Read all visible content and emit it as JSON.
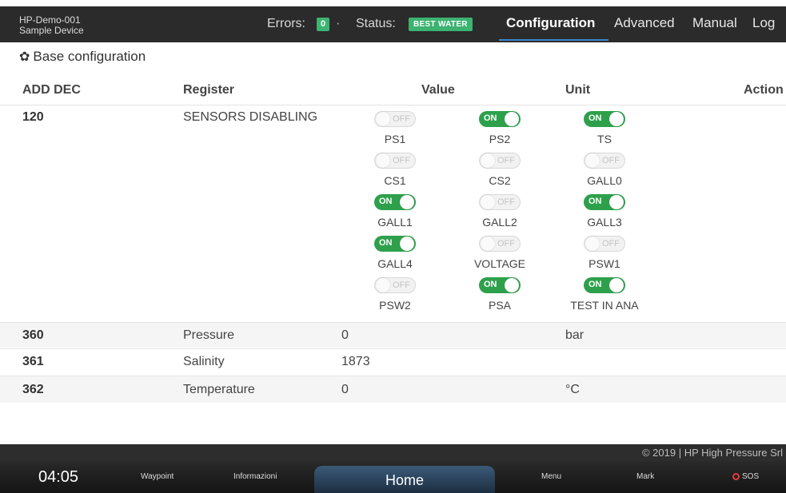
{
  "header": {
    "device_id": "HP-Demo-001",
    "device_name": "Sample Device",
    "errors_label": "Errors:",
    "errors_count": "0",
    "separator": "·",
    "status_label": "Status:",
    "status_value": "BEST WATER",
    "nav": [
      "Configuration",
      "Advanced",
      "Manual",
      "Log"
    ],
    "active_nav": "Configuration",
    "accent_color": "#3cb371"
  },
  "section": {
    "icon": "gear-icon",
    "title": "Base configuration"
  },
  "table": {
    "columns": [
      "ADD DEC",
      "Register",
      "Value",
      "Unit",
      "Action"
    ],
    "sensor_row": {
      "addr": "120",
      "register": "SENSORS DISABLING"
    },
    "on_text": "ON",
    "off_text": "OFF",
    "toggles": [
      {
        "label": "PS1",
        "state": "off"
      },
      {
        "label": "PS2",
        "state": "on"
      },
      {
        "label": "TS",
        "state": "on"
      },
      {
        "label": "CS1",
        "state": "off"
      },
      {
        "label": "CS2",
        "state": "off"
      },
      {
        "label": "GALL0",
        "state": "off"
      },
      {
        "label": "GALL1",
        "state": "on"
      },
      {
        "label": "GALL2",
        "state": "off"
      },
      {
        "label": "GALL3",
        "state": "on"
      },
      {
        "label": "GALL4",
        "state": "on"
      },
      {
        "label": "VOLTAGE",
        "state": "off"
      },
      {
        "label": "PSW1",
        "state": "off"
      },
      {
        "label": "PSW2",
        "state": "off"
      },
      {
        "label": "PSA",
        "state": "on"
      },
      {
        "label": "TEST IN ANA",
        "state": "on"
      }
    ],
    "rows": [
      {
        "addr": "360",
        "register": "Pressure",
        "value": "0",
        "unit": "bar"
      },
      {
        "addr": "361",
        "register": "Salinity",
        "value": "1873",
        "unit": ""
      },
      {
        "addr": "362",
        "register": "Temperature",
        "value": "0",
        "unit": "°C"
      }
    ]
  },
  "footer": {
    "copyright": "© 2019  |  HP High Pressure Srl",
    "clock": "04:05",
    "buttons": [
      "Waypoint",
      "Informazioni",
      "Home",
      "Menu",
      "Mark",
      "SOS"
    ],
    "sos_color": "#e53b3b"
  }
}
